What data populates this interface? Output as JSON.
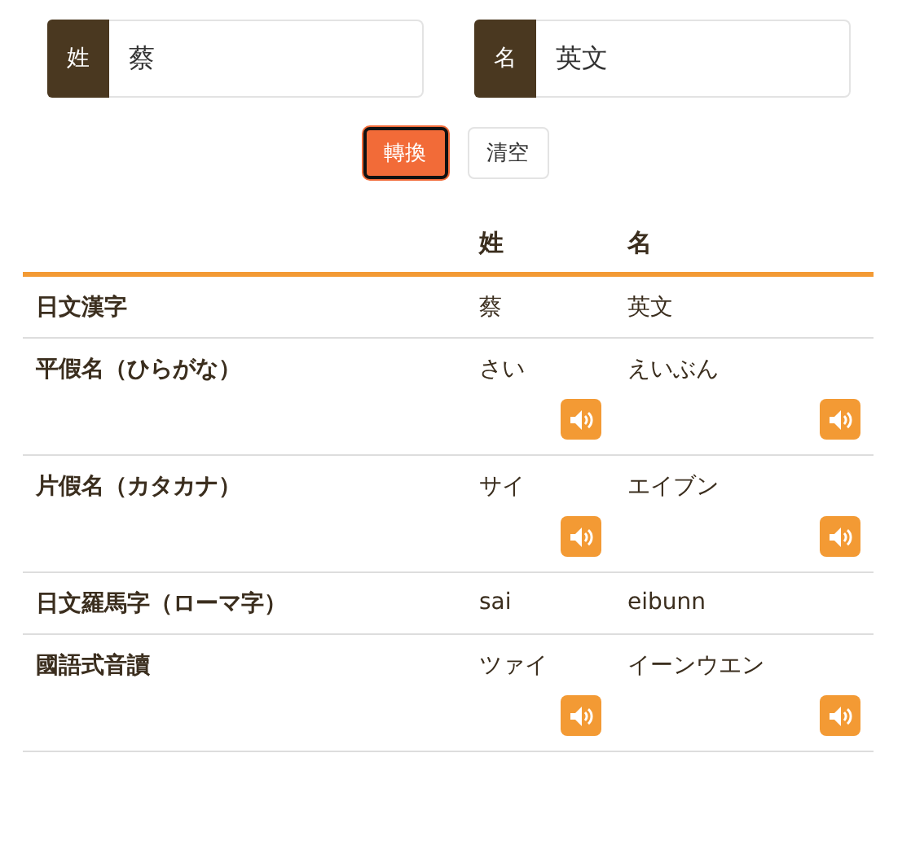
{
  "fields": [
    {
      "label": "姓",
      "value": "蔡"
    },
    {
      "label": "名",
      "value": "英文"
    }
  ],
  "buttons": [
    {
      "label": "轉換",
      "kind": "primary",
      "focused": true
    },
    {
      "label": "清空",
      "kind": "plain",
      "focused": false
    }
  ],
  "table": {
    "columns": [
      "姓",
      "名"
    ],
    "rows": [
      {
        "label": "日文漢字",
        "sei": "蔡",
        "mei": "英文",
        "audio": false
      },
      {
        "label": "平假名（ひらがな）",
        "sei": "さい",
        "mei": "えいぶん",
        "audio": true
      },
      {
        "label": "片假名（カタカナ）",
        "sei": "サイ",
        "mei": "エイブン",
        "audio": true
      },
      {
        "label": "日文羅馬字（ローマ字）",
        "sei": "sai",
        "mei": "eibunn",
        "audio": false
      },
      {
        "label": "國語式音讀",
        "sei": "ツァイ",
        "mei": "イーンウエン",
        "audio": true
      }
    ]
  }
}
